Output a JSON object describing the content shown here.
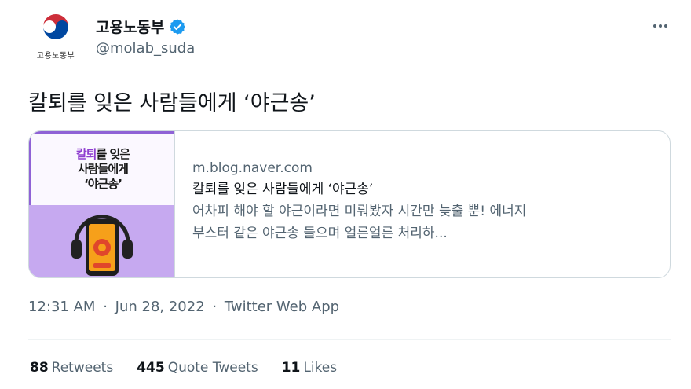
{
  "author": {
    "display_name": "고용노동부",
    "handle": "@molab_suda",
    "logo_caption": "고용노동부",
    "verified": true
  },
  "tweet": {
    "text": "칼퇴를 잊은 사람들에게 ‘야근송’"
  },
  "card": {
    "thumbnail": {
      "line1_highlight": "칼퇴",
      "line1_rest": "를 잊은",
      "line2": "사람들에게",
      "line3": "‘야근송’"
    },
    "domain": "m.blog.naver.com",
    "title": "칼퇴를 잊은 사람들에게 ‘야근송’",
    "description_line1": "어차피 해야 할 야근이라면 미뤄봤자 시간만 늦출 뿐! 에너지",
    "description_line2": "부스터 같은 야근송 들으며 얼른얼른 처리하..."
  },
  "meta": {
    "time": "12:31 AM",
    "separator": "·",
    "date": "Jun 28, 2022",
    "source": "Twitter Web App"
  },
  "stats": [
    {
      "count": "88",
      "label": "Retweets"
    },
    {
      "count": "445",
      "label": "Quote Tweets"
    },
    {
      "count": "11",
      "label": "Likes"
    }
  ],
  "icons": {
    "more": "more-options-icon",
    "verified": "verified-badge-icon",
    "logo": "taegeuk-logo-icon"
  },
  "colors": {
    "verified_blue": "#1d9bf0",
    "text_secondary": "#536471",
    "card_border": "#cfd9de",
    "thumb_purple": "#c6a9f0",
    "logo_red": "#cd2e3a",
    "logo_blue": "#0047a0"
  }
}
